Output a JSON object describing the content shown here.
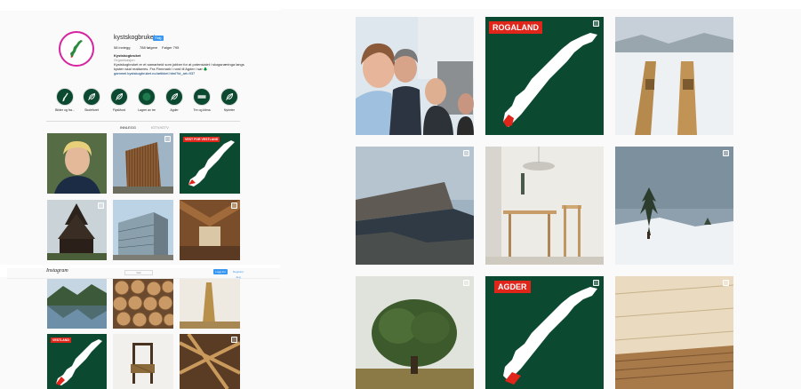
{
  "profile": {
    "username": "kystskogbruket",
    "follow_label": "Følg",
    "stats": [
      "58 innlegg",
      "788 følgere",
      "Følger 795"
    ],
    "name": "Kystskogbruket",
    "category": "Organisasjon",
    "bio_line1": "Kystskogbruket er et samarbeid som jobber for at potensialet i skogsnæringa langs",
    "bio_line2": "kysten skal realiseres. Fra Finnmark i nord til Agder i sør 🌲",
    "bio_link": "gammel.kystskogbruket.no/artikkel.html?id_art=937"
  },
  "highlights": [
    {
      "label": "Bilder og fra..."
    },
    {
      "label": "Skolefuret"
    },
    {
      "label": "Flyskfurd"
    },
    {
      "label": "Lagrer av tre"
    },
    {
      "label": "Agder"
    },
    {
      "label": "Tre og klima"
    },
    {
      "label": "Nyheter"
    }
  ],
  "tabs": [
    "INNLEGG",
    "IGTV/IGTV"
  ],
  "left_badges": {
    "vestland": "VESTLAND",
    "vest": "VEST FOR VESTLAND"
  },
  "topbar": {
    "logo": "Instagram",
    "search": "Søk",
    "login": "Logg inn",
    "signup": "Registrer deg"
  },
  "right_badges": {
    "rogaland": "ROGALAND",
    "agder": "AGDER"
  },
  "colors": {
    "forest": "#0b4a31",
    "badge": "#e0251b",
    "instagram_blue": "#3897f0"
  }
}
